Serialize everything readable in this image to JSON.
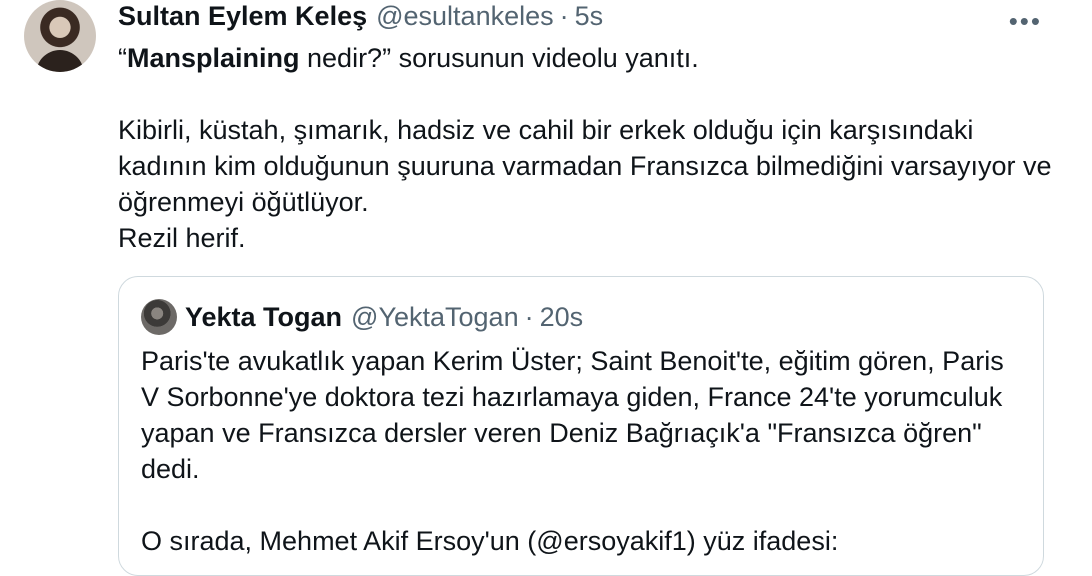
{
  "tweet": {
    "author_name": "Sultan Eylem Keleş",
    "author_handle": "@esultankeles",
    "separator": "·",
    "time": "5s",
    "more_label": "•••",
    "text_bold": "Mansplaining",
    "text_open_quote": "“",
    "text_after_bold": " nedir?” sorusunun videolu yanıtı.\n\nKibirli, küstah, şımarık, hadsiz ve cahil bir erkek olduğu için karşısındaki kadının kim olduğunun şuuruna varmadan Fransızca bilmediğini varsayıyor ve öğrenmeyi öğütlüyor.\nRezil herif."
  },
  "quoted": {
    "author_name": "Yekta Togan",
    "author_handle": "@YektaTogan",
    "separator": "·",
    "time": "20s",
    "text": "Paris'te avukatlık yapan Kerim Üster; Saint Benoit'te, eğitim gören, Paris V Sorbonne'ye doktora tezi hazırlamaya giden, France 24'te yorumculuk yapan ve Fransızca dersler veren Deniz Bağrıaçık'a \"Fransızca öğren\" dedi.\n\nO sırada, Mehmet Akif Ersoy'un (@ersoyakif1) yüz ifadesi:"
  }
}
